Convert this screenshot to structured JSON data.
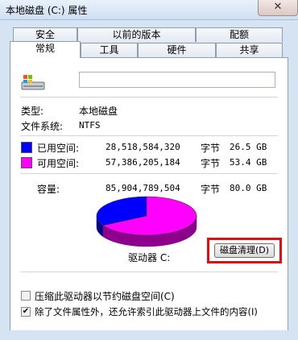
{
  "window": {
    "title": "本地磁盘 (C:) 属性",
    "close_glyph": "✕"
  },
  "tabs_row1": [
    "安全",
    "以前的版本",
    "配额"
  ],
  "tabs_row2": [
    "常规",
    "工具",
    "硬件",
    "共享"
  ],
  "active_tab": "常规",
  "general": {
    "drive_icon": "drive-icon",
    "name_value": "",
    "type_label": "类型:",
    "type_value": "本地磁盘",
    "fs_label": "文件系统:",
    "fs_value": "NTFS",
    "used": {
      "label": "已用空间:",
      "bytes": "28,518,584,320",
      "unit": "字节",
      "size": "26.5 GB",
      "color": "#0000ff"
    },
    "free": {
      "label": "可用空间:",
      "bytes": "57,386,205,184",
      "unit": "字节",
      "size": "53.4 GB",
      "color": "#ff00ff"
    },
    "capacity": {
      "label": "容量:",
      "bytes": "85,904,789,504",
      "unit": "字节",
      "size": "80.0 GB"
    },
    "drive_label": "驱动器 C:",
    "cleanup_button": "磁盘清理(D)",
    "compress_checkbox": {
      "label": "压缩此驱动器以节约磁盘空间(C)",
      "checked": false
    },
    "index_checkbox": {
      "label": "除了文件属性外，还允许索引此驱动器上文件的内容(I)",
      "checked": true
    }
  },
  "chart_data": {
    "type": "pie",
    "values": [
      28518584320,
      57386205184
    ],
    "colors": [
      "#0000ff",
      "#ff00ff"
    ]
  }
}
